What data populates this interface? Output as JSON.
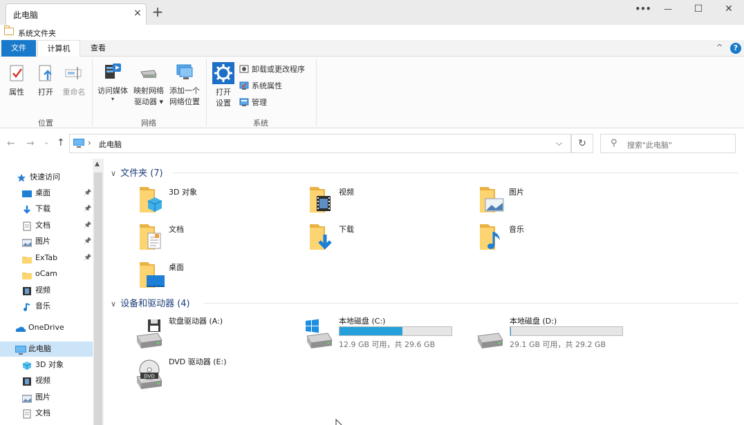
{
  "titlebar": {
    "tab_title": "此电脑",
    "tab_close": "×",
    "new_tab": "+",
    "more": "•••",
    "minimize": "—",
    "maximize": "☐",
    "close": "✕"
  },
  "folder_strip": {
    "label": "系统文件夹"
  },
  "ribbon_tabs": {
    "file": "文件",
    "computer": "计算机",
    "view": "查看",
    "collapse": "^",
    "help": "?"
  },
  "ribbon": {
    "location_group": "位置",
    "network_group": "网络",
    "system_group": "系统",
    "properties": "属性",
    "open": "打开",
    "rename": "重命名",
    "access_media": "访问媒体",
    "map_drive_1": "映射网络",
    "map_drive_2": "驱动器 ▾",
    "add_location_1": "添加一个",
    "add_location_2": "网络位置",
    "open_settings_1": "打开",
    "open_settings_2": "设置",
    "uninstall": "卸载或更改程序",
    "system_props": "系统属性",
    "manage": "管理"
  },
  "address": {
    "path": "此电脑",
    "separator": "›",
    "dropdown": "⌵",
    "refresh": "↻",
    "search_icon": "⚲",
    "search_placeholder": "搜索\"此电脑\""
  },
  "nav": {
    "back": "←",
    "forward": "→",
    "recent": "⌄",
    "up": "↑"
  },
  "sidebar": {
    "items": [
      {
        "label": "快速访问",
        "icon": "star-icon"
      },
      {
        "label": "桌面",
        "icon": "desktop-icon",
        "pinned": true
      },
      {
        "label": "下载",
        "icon": "download-icon",
        "pinned": true
      },
      {
        "label": "文档",
        "icon": "document-icon",
        "pinned": true
      },
      {
        "label": "图片",
        "icon": "picture-icon",
        "pinned": true
      },
      {
        "label": "ExTab",
        "icon": "folder-icon",
        "pinned": true
      },
      {
        "label": "oCam",
        "icon": "folder-icon"
      },
      {
        "label": "视频",
        "icon": "video-icon"
      },
      {
        "label": "音乐",
        "icon": "music-icon"
      },
      {
        "label": "OneDrive",
        "icon": "cloud-icon"
      },
      {
        "label": "此电脑",
        "icon": "pc-icon",
        "selected": true
      },
      {
        "label": "3D 对象",
        "icon": "cube-icon"
      },
      {
        "label": "视频",
        "icon": "video-icon"
      },
      {
        "label": "图片",
        "icon": "picture-icon"
      },
      {
        "label": "文档",
        "icon": "document-icon"
      }
    ]
  },
  "folders_section": {
    "title": "文件夹 (7)",
    "items": [
      {
        "label": "3D 对象",
        "icon": "cube-folder-icon"
      },
      {
        "label": "视频",
        "icon": "video-folder-icon"
      },
      {
        "label": "图片",
        "icon": "picture-folder-icon"
      },
      {
        "label": "文档",
        "icon": "document-folder-icon"
      },
      {
        "label": "下载",
        "icon": "download-folder-icon"
      },
      {
        "label": "音乐",
        "icon": "music-folder-icon"
      },
      {
        "label": "桌面",
        "icon": "desktop-folder-icon"
      }
    ]
  },
  "drives_section": {
    "title": "设备和驱动器 (4)",
    "items": [
      {
        "label": "软盘驱动器 (A:)",
        "icon": "floppy-drive-icon"
      },
      {
        "label": "本地磁盘 (C:)",
        "icon": "windows-drive-icon",
        "size": "12.9 GB 可用，共 29.6 GB",
        "used_fraction": 0.56
      },
      {
        "label": "本地磁盘 (D:)",
        "icon": "hard-drive-icon",
        "size": "29.1 GB 可用，共 29.2 GB",
        "used_fraction": 0.004
      },
      {
        "label": "DVD 驱动器 (E:)",
        "icon": "dvd-drive-icon",
        "disc_text": "DVD"
      }
    ]
  },
  "colors": {
    "accent": "#1979ca",
    "drive_bar": "#26a0da",
    "selected": "#cce4f7",
    "section_title": "#1e3f7a"
  }
}
